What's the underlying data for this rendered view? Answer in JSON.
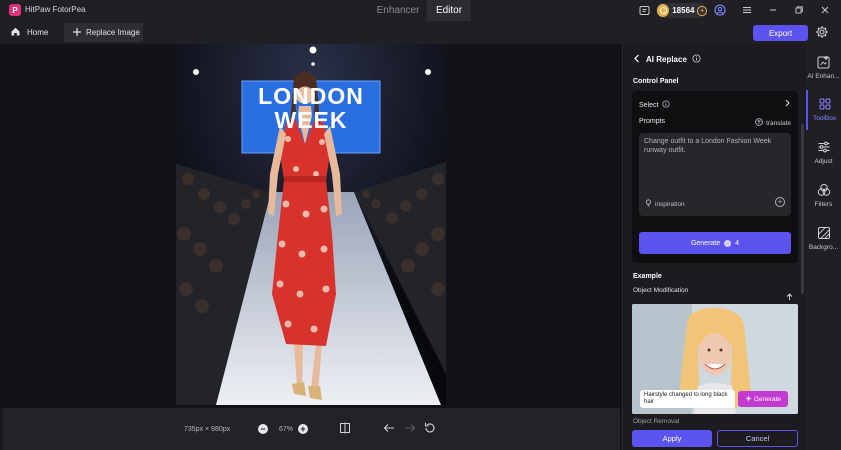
{
  "app": {
    "title": "HitPaw FotorPea"
  },
  "modes": {
    "enhancer": "Enhancer",
    "editor": "Editor"
  },
  "credits": {
    "value": "18564"
  },
  "toolbar": {
    "home": "Home",
    "replace_image": "Replace Image",
    "export": "Export"
  },
  "canvas": {
    "dims": "735px × 980px",
    "zoom": "67%"
  },
  "panel": {
    "title": "AI Replace",
    "control_panel": "Control Panel",
    "select_label": "Select",
    "prompts_label": "Prompts",
    "translate_label": "translate",
    "prompt_text": "Change outfit to a London Fashion Week runway outfit.",
    "inspiration": "inspiration",
    "generate_label": "Generate",
    "generate_cost": "4",
    "example_label": "Example",
    "object_modification": "Object Modification",
    "example_caption": "Hairstyle changed to long black hair",
    "example_generate": "Generate",
    "peek_text": "Object Removal",
    "apply": "Apply",
    "cancel": "Cancel"
  },
  "photo": {
    "sign_line1": "LONDON",
    "sign_line2": "WEEK"
  },
  "rail": [
    {
      "label": "AI Enhan...",
      "icon": "ai-enhancer-icon"
    },
    {
      "label": "ToolBox",
      "icon": "toolbox-icon"
    },
    {
      "label": "Adjust",
      "icon": "adjust-icon"
    },
    {
      "label": "Filters",
      "icon": "filters-icon"
    },
    {
      "label": "Backgro...",
      "icon": "background-icon"
    }
  ],
  "colors": {
    "accent": "#5b53f0",
    "dress": "#d8322c",
    "coin": "#e8b04a"
  }
}
